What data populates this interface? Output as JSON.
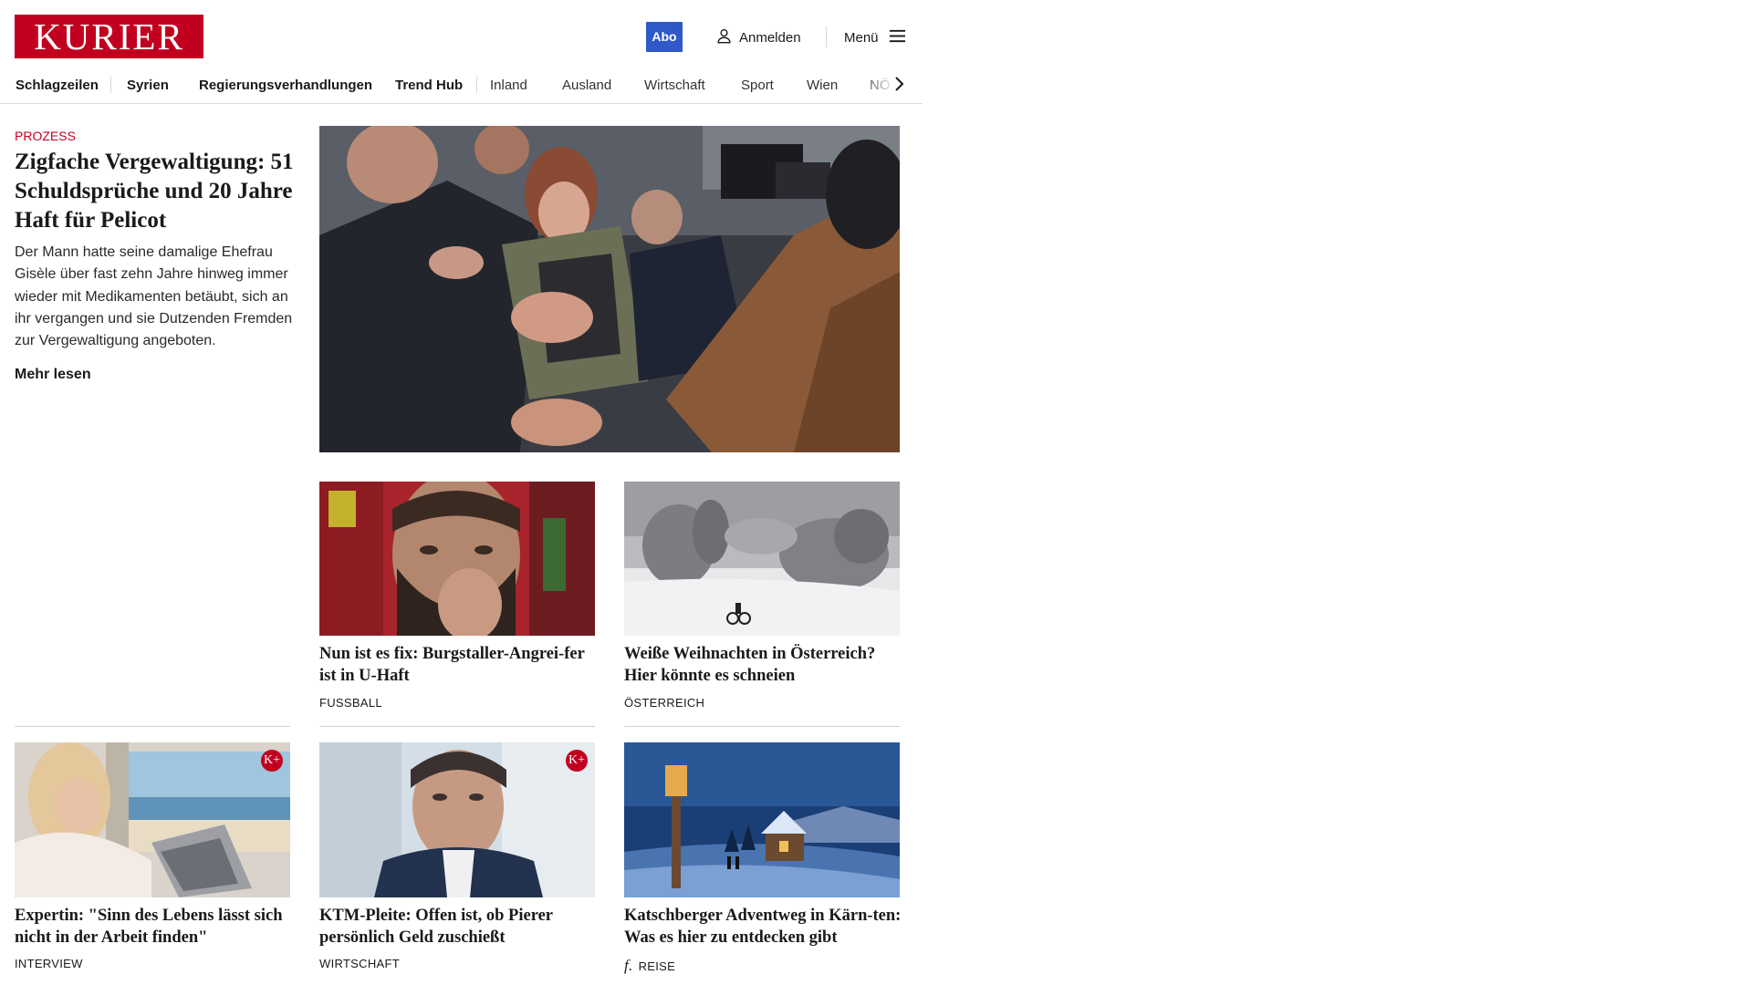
{
  "header": {
    "logo": "KURIER",
    "abo": "Abo",
    "login": "Anmelden",
    "menu": "Menü"
  },
  "nav": {
    "items": [
      "Schlagzeilen",
      "Syrien",
      "Regierungsverhandlungen",
      "Trend Hub",
      "Inland",
      "Ausland",
      "Wirtschaft",
      "Sport",
      "Wien",
      "NÖ"
    ]
  },
  "lead": {
    "kicker": "PROZESS",
    "title": "Zigfache Vergewaltigung: 51 Schuldsprüche und 20 Jahre Haft für Pelicot",
    "text": "Der Mann hatte seine damalige Ehefrau Gisèle über fast zehn Jahre hinweg immer wieder mit Medikamenten betäubt, sich an ihr vergangen und sie Dutzenden Fremden zur Vergewaltigung angeboten.",
    "more": "Mehr lesen"
  },
  "cards": [
    {
      "title": "Nun ist es fix: Burgstaller-Angrei-fer ist in U-Haft",
      "category": "FUSSBALL"
    },
    {
      "title": "Weiße Weihnachten in Österreich? Hier könnte es schneien",
      "category": "ÖSTERREICH"
    },
    {
      "title": "Expertin: \"Sinn des Lebens lässt sich nicht in der Arbeit finden\"",
      "category": "INTERVIEW",
      "badge": "K+"
    },
    {
      "title": "KTM-Pleite: Offen ist, ob Pierer persönlich Geld zuschießt",
      "category": "WIRTSCHAFT",
      "badge": "K+"
    },
    {
      "title": "Katschberger Adventweg in Kärn-ten: Was es hier zu entdecken gibt",
      "category": "REISE",
      "sponsor_mark": "f."
    }
  ],
  "icons": {
    "login": "user-icon",
    "menu": "hamburger-icon",
    "nav_next": "chevron-right-icon",
    "badge": "kurier-plus-icon"
  },
  "colors": {
    "brand": "#c1001f",
    "abo": "#2f59c6"
  }
}
